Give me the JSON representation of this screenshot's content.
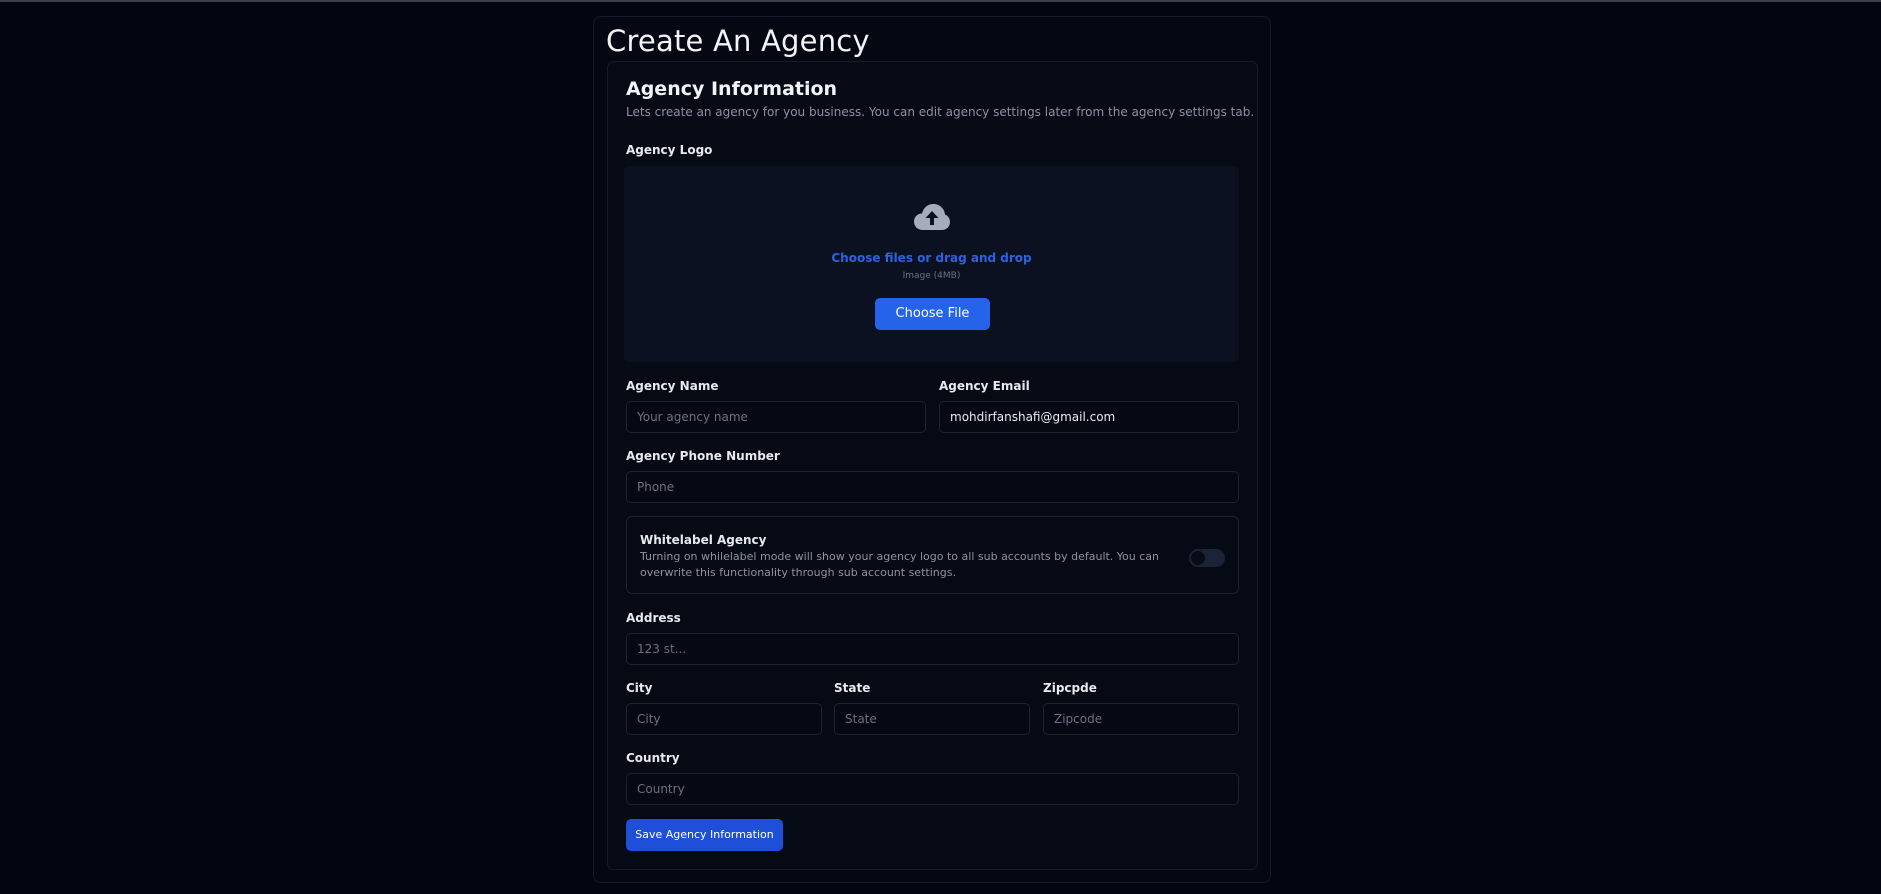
{
  "page": {
    "title": "Create An Agency"
  },
  "form": {
    "title": "Agency Information",
    "description": "Lets create an agency for you business. You can edit agency settings later from the agency settings tab.",
    "logo": {
      "label": "Agency Logo",
      "icon": "cloud-upload-icon",
      "drop_text": "Choose files or drag and drop",
      "hint": "Image (4MB)",
      "button_label": "Choose File"
    },
    "agency_name": {
      "label": "Agency Name",
      "value": "",
      "placeholder": "Your agency name"
    },
    "agency_email": {
      "label": "Agency Email",
      "value": "mohdirfanshafi@gmail.com",
      "placeholder": ""
    },
    "phone": {
      "label": "Agency Phone Number",
      "value": "",
      "placeholder": "Phone"
    },
    "whitelabel": {
      "title": "Whitelabel Agency",
      "description": "Turning on whilelabel mode will show your agency logo to all sub accounts by default. You can overwrite this functionality through sub account settings.",
      "enabled": false
    },
    "address": {
      "label": "Address",
      "value": "",
      "placeholder": "123 st..."
    },
    "city": {
      "label": "City",
      "value": "",
      "placeholder": "City"
    },
    "state": {
      "label": "State",
      "value": "",
      "placeholder": "State"
    },
    "zipcode": {
      "label": "Zipcpde",
      "value": "",
      "placeholder": "Zipcode"
    },
    "country": {
      "label": "Country",
      "value": "",
      "placeholder": "Country"
    },
    "submit_label": "Save Agency Information"
  },
  "colors": {
    "background": "#020610",
    "accent": "#2563eb",
    "link": "#2d63de"
  }
}
